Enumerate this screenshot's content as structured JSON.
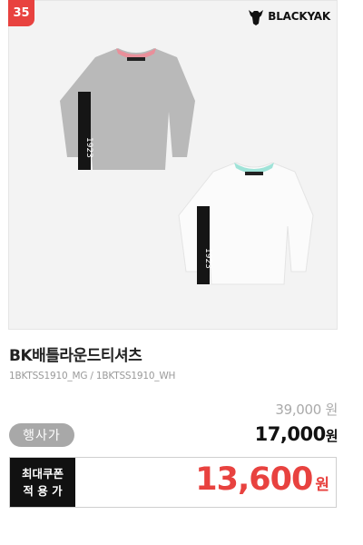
{
  "rank": "35",
  "brand": {
    "name": "BLACKYAK",
    "icon": "yak-head-icon"
  },
  "product": {
    "title": "BK배틀라운드티셔츠",
    "codes": "1BKTSS1910_MG / 1BKTSS1910_WH"
  },
  "price": {
    "original": "39,000 원",
    "badge": "행사가",
    "sale_value": "17,000",
    "sale_unit": "원"
  },
  "coupon": {
    "label_line1": "최대쿠폰",
    "label_line2": "적 용 가",
    "value": "13,600",
    "unit": "원"
  },
  "colors": {
    "accent": "#e8423f",
    "badge_bg": "#a8a8a8",
    "label_bg": "#111111"
  }
}
